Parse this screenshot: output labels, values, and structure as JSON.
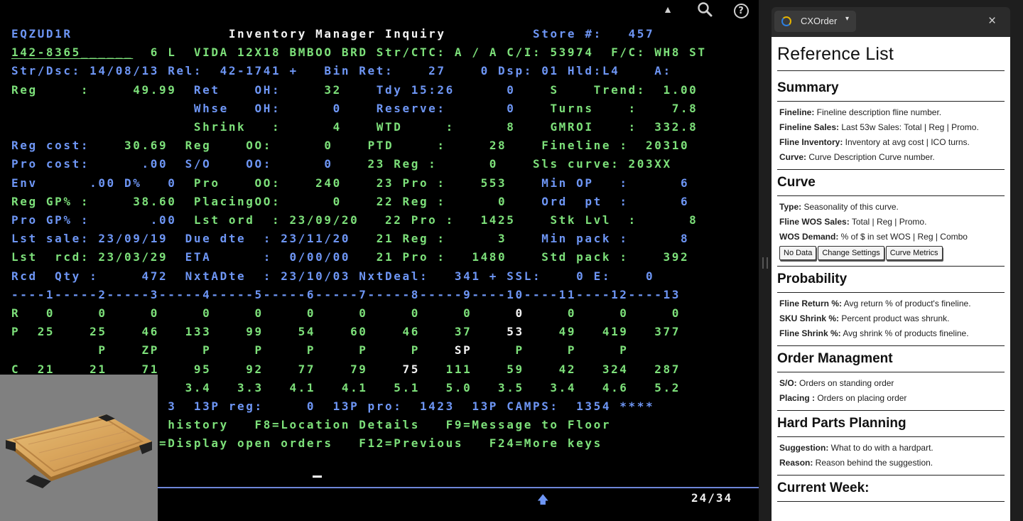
{
  "terminal": {
    "toolbar": {
      "up_icon": "triangle-up-icon",
      "search_icon": "search-icon",
      "help_icon": "help-icon",
      "help_glyph": "?"
    },
    "lines": [
      [
        {
          "t": "EQZUD1R                  ",
          "c": "b"
        },
        {
          "t": "Inventory Manager Inquiry",
          "c": "w"
        },
        {
          "t": "          Store #:   457",
          "c": "b"
        }
      ],
      [
        {
          "t": "142-8365______",
          "c": "g",
          "u": true
        },
        {
          "t": "  6 L  VIDA 12X18 BMBOO BRD ",
          "c": "g"
        },
        {
          "t": "Str/CTC: A / A C/I: 53974  F/C: WH8 ST",
          "c": "g"
        }
      ],
      [
        {
          "t": "Str/Dsc: 14/08/13 Rel:  42-1741 +   Bin Ret:    27    0 Dsp: 01 Hld:L4    A:",
          "c": "b"
        }
      ],
      [
        {
          "t": "Reg     :     49.99  ",
          "c": "g"
        },
        {
          "t": "Ret    OH:     ",
          "c": "b"
        },
        {
          "t": "32    ",
          "c": "g"
        },
        {
          "t": "Tdy 15:26      0    ",
          "c": "b"
        },
        {
          "t": "S    Trend:  1.00",
          "c": "g"
        }
      ],
      [
        {
          "t": "                     ",
          "c": "g"
        },
        {
          "t": "Whse   OH:      0    ",
          "c": "b"
        },
        {
          "t": "Reserve:       0    ",
          "c": "b"
        },
        {
          "t": "Turns    :    7.8",
          "c": "g"
        }
      ],
      [
        {
          "t": "                     ",
          "c": "g"
        },
        {
          "t": "Shrink   :      4    ",
          "c": "g"
        },
        {
          "t": "WTD     :      8    ",
          "c": "g"
        },
        {
          "t": "GMROI    :  332.8",
          "c": "g"
        }
      ],
      [
        {
          "t": "Reg cost:    ",
          "c": "b"
        },
        {
          "t": "30.69  ",
          "c": "g"
        },
        {
          "t": "Reg    OO:      0    ",
          "c": "g"
        },
        {
          "t": "PTD     :     28    ",
          "c": "g"
        },
        {
          "t": "Fineline :  20310",
          "c": "g"
        }
      ],
      [
        {
          "t": "Pro cost:      .00  ",
          "c": "b"
        },
        {
          "t": "S/O    OO:      0    ",
          "c": "b"
        },
        {
          "t": "23 Reg :      0    ",
          "c": "g"
        },
        {
          "t": "Sls curve: 203XX",
          "c": "g"
        }
      ],
      [
        {
          "t": "Env      .00 D%   0  ",
          "c": "b"
        },
        {
          "t": "Pro    OO:    240    ",
          "c": "g"
        },
        {
          "t": "23 Pro :    553    ",
          "c": "g"
        },
        {
          "t": "Min OP   :      6",
          "c": "b"
        }
      ],
      [
        {
          "t": "Reg GP% :     38.60  ",
          "c": "g"
        },
        {
          "t": "PlacingOO:      0    ",
          "c": "g"
        },
        {
          "t": "22 Reg :      0    ",
          "c": "g"
        },
        {
          "t": "Ord  pt  :      6",
          "c": "b"
        }
      ],
      [
        {
          "t": "Pro GP% :       .00  ",
          "c": "b"
        },
        {
          "t": "Lst ord  : 23/09/20   ",
          "c": "g"
        },
        {
          "t": "22 Pro :   1425    ",
          "c": "g"
        },
        {
          "t": "Stk Lvl  :      8",
          "c": "g"
        }
      ],
      [
        {
          "t": "Lst sale: 23/09/19  ",
          "c": "b"
        },
        {
          "t": "Due dte  : 23/11/20   ",
          "c": "b"
        },
        {
          "t": "21 Reg :      3    ",
          "c": "g"
        },
        {
          "t": "Min pack :      8",
          "c": "b"
        }
      ],
      [
        {
          "t": "Lst  rcd: 23/03/29  ",
          "c": "g"
        },
        {
          "t": "ETA      :  0/00/00   ",
          "c": "b"
        },
        {
          "t": "21 Pro :   1480    ",
          "c": "g"
        },
        {
          "t": "Std pack :    392",
          "c": "g"
        }
      ],
      [
        {
          "t": "Rcd  Qty :     472  ",
          "c": "b"
        },
        {
          "t": "NxtADte  : 23/10/03 NxtDeal:   341 + SSL:    0 E:    0",
          "c": "b"
        }
      ],
      [
        {
          "t": "----1-----2-----3-----4-----5-----6-----7-----8-----9----10----11----12----13",
          "c": "b"
        }
      ],
      [
        {
          "t": "R   0     0     0     0     0     0     0     0     0     ",
          "c": "g"
        },
        {
          "t": "0",
          "c": "w"
        },
        {
          "t": "     0     0     0",
          "c": "g"
        }
      ],
      [
        {
          "t": "P  25    25    46   133    99    54    60    46    37    ",
          "c": "g"
        },
        {
          "t": "53",
          "c": "w"
        },
        {
          "t": "    49   419   377",
          "c": "g"
        }
      ],
      [
        {
          "t": "          ",
          "c": "g"
        },
        {
          "t": "P    ZP     P     P     P     P     P    ",
          "c": "g"
        },
        {
          "t": "SP",
          "c": "w"
        },
        {
          "t": "     P     P     P",
          "c": "g"
        }
      ],
      [
        {
          "t": "C  21    21    71    95    92    77    79    ",
          "c": "g"
        },
        {
          "t": "75",
          "c": "w"
        },
        {
          "t": "   111    59    42   324   287",
          "c": "g"
        }
      ],
      [
        {
          "t": "F 3.5   3.2   3.6   3.4   3.3   4.1   4.1   5.1   5.0   3.5   3.4   4.6   5.2",
          "c": "g"
        }
      ],
      [
        {
          "t": "**** 13P est:     3  13P reg:     0  13P pro:  1423  13P CAMPS:  1354 ****",
          "c": "b"
        }
      ],
      [
        {
          "t": "F3=Exit  F5=Sales history   F8=Location Details   F9=Message to Floor",
          "c": "g"
        }
      ],
      [
        {
          "t": "F10=Upd prd   F11=Display open orders   F12=Previous   F24=More keys",
          "c": "g"
        }
      ]
    ],
    "page_counter": "24/34",
    "scroll_icon": "arrow-up-icon"
  },
  "thumbnail": {
    "icon": "cutting-board-product-image"
  },
  "panel": {
    "app_name": "CXOrder",
    "caret": "▾",
    "close": "×",
    "title": "Reference List",
    "sections": [
      {
        "heading": "Summary",
        "items": [
          {
            "k": "Fineline:",
            "v": " Fineline description fline number."
          },
          {
            "k": "Fineline Sales:",
            "v": " Last 53w Sales: Total | Reg | Promo."
          },
          {
            "k": "Fline Inventory:",
            "v": " Inventory at avg cost | ICO turns."
          },
          {
            "k": "Curve:",
            "v": " Curve Description Curve number."
          }
        ]
      },
      {
        "heading": "Curve",
        "items": [
          {
            "k": "Type:",
            "v": " Seasonality of this curve."
          },
          {
            "k": "Fline WOS Sales:",
            "v": " Total | Reg | Promo."
          },
          {
            "k": "WOS Demand:",
            "v": " % of $ in set WOS | Reg | Combo"
          }
        ],
        "buttons": [
          "No Data",
          "Change Settings",
          "Curve Metrics"
        ]
      },
      {
        "heading": "Probability",
        "items": [
          {
            "k": "Fline Return %:",
            "v": " Avg return % of product's fineline."
          },
          {
            "k": "SKU Shrink %:",
            "v": " Percent product was shrunk."
          },
          {
            "k": "Fline Shrink %:",
            "v": " Avg shrink % of products fineline."
          }
        ]
      },
      {
        "heading": "Order Managment",
        "items": [
          {
            "k": "S/O:",
            "v": " Orders on standing order"
          },
          {
            "k": "Placing :",
            "v": " Orders on placing order"
          }
        ]
      },
      {
        "heading": "Hard Parts Planning",
        "items": [
          {
            "k": "Suggestion:",
            "v": " What to do with a hardpart."
          },
          {
            "k": "Reason:",
            "v": " Reason behind the suggestion."
          }
        ]
      }
    ],
    "current_week": "Current Week:"
  }
}
